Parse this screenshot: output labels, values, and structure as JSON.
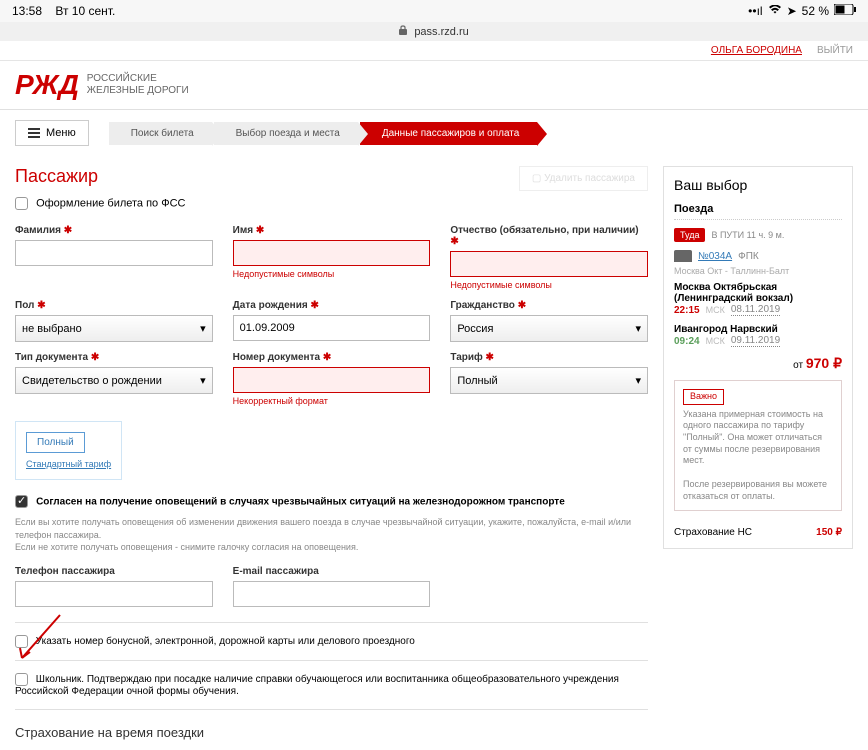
{
  "status": {
    "time": "13:58",
    "date": "Вт 10 сент.",
    "battery": "52 %"
  },
  "url": "pass.rzd.ru",
  "brand": {
    "mark": "РЖД",
    "line1": "Российские",
    "line2": "железные дороги"
  },
  "topmenu": {
    "user": "ОЛЬГА БОРОДИНА",
    "exit": "ВЫЙТИ"
  },
  "menu": {
    "label": "Меню"
  },
  "breadcrumb": {
    "s1": "Поиск билета",
    "s2": "Выбор поезда и места",
    "s3": "Данные пассажиров и оплата"
  },
  "page": {
    "title": "Пассажир",
    "delete": "Удалить пассажира",
    "fss": "Оформление билета по ФСС"
  },
  "labels": {
    "surname": "Фамилия",
    "name": "Имя",
    "patronymic": "Отчество (обязательно, при наличии)",
    "gender": "Пол",
    "dob": "Дата рождения",
    "citizenship": "Гражданство",
    "doctype": "Тип документа",
    "docnum": "Номер документа",
    "tariff": "Тариф",
    "phone": "Телефон пассажира",
    "email": "E-mail пассажира"
  },
  "values": {
    "surname": "",
    "name": "",
    "patronymic": "",
    "gender": "не выбрано",
    "dob": "01.09.2009",
    "citizenship": "Россия",
    "doctype": "Свидетельство о рождении",
    "docnum": "",
    "tariff": "Полный",
    "phone": "",
    "email": ""
  },
  "errors": {
    "name": "Недопустимые символы",
    "patronymic": "Недопустимые символы",
    "docnum": "Некорректный формат"
  },
  "tariff": {
    "tag": "Полный",
    "link": "Стандартный тариф"
  },
  "consent": {
    "label": "Согласен на получение оповещений в случаях чрезвычайных ситуаций на железнодорожном транспорте",
    "text1": "Если вы хотите получать оповещения об изменении движения вашего поезда в случае чрезвычайной ситуации, укажите, пожалуйста, e-mail и/или телефон пассажира.",
    "text2": "Если не хотите получать оповещения - снимите галочку согласия на оповещения."
  },
  "bonus": "Указать номер бонусной, электронной, дорожной карты или делового проездного",
  "student": "Школьник. Подтверждаю при посадке наличие справки обучающегося или воспитанника общеобразовательного учреждения Российской Федерации очной формы обучения.",
  "travel_insurance_title": "Страхование на время поездки",
  "sidebar": {
    "title": "Ваш выбор",
    "trains": "Поезда",
    "dir": "Туда",
    "travel": "В ПУТИ 11 ч. 9 м.",
    "num": "№034А",
    "company": "ФПК",
    "route": "Москва Окт - Таллинн-Балт",
    "dep_station": "Москва Октябрьская (Ленинградский вокзал)",
    "dep_time": "22:15",
    "dep_tz": "МСК",
    "dep_date": "08.11.2019",
    "arr_station": "Ивангород Нарвский",
    "arr_time": "09:24",
    "arr_tz": "МСК",
    "arr_date": "09.11.2019",
    "price_from": "от",
    "price_val": "970 ₽",
    "important": "Важно",
    "important_text": "Указана примерная стоимость на одного пассажира по тарифу \"Полный\". Она может отличаться от суммы после резервирования мест.",
    "important_text2": "После резервирования вы можете отказаться от оплаты.",
    "insurance": "Страхование НС",
    "ins_price": "150 ₽"
  }
}
